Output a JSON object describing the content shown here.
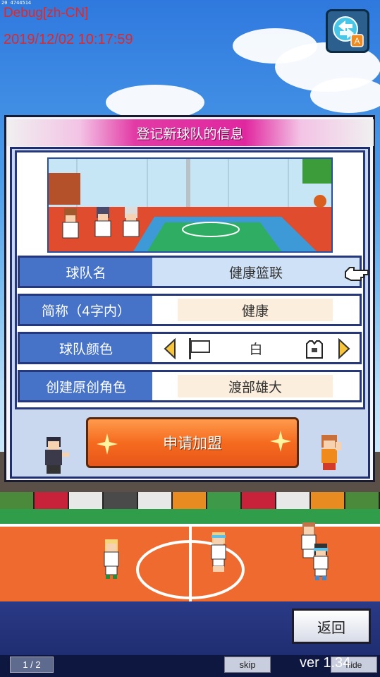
{
  "debug": {
    "build_id": "20 4744514",
    "language": "Debug[zh-CN]",
    "datetime": "2019/12/02 10:17:59"
  },
  "dialog": {
    "title": "登记新球队的信息",
    "rows": [
      {
        "label": "球队名",
        "value": "健康篮联"
      },
      {
        "label": "简称（4字内）",
        "value": "健康"
      },
      {
        "label": "球队颜色",
        "value": "白"
      },
      {
        "label": "创建原创角色",
        "value": "渡部雄大"
      }
    ],
    "join_button": "申请加盟"
  },
  "footer": {
    "back_button": "返回",
    "page_indicator": "1 / 2",
    "skip_button": "skip",
    "version": "ver 1.34",
    "hide_button": "hide"
  },
  "icons": {
    "language_switch": "globe-translate-icon",
    "pointer": "pointing-hand-icon",
    "flag": "flag-icon",
    "jersey": "jersey-icon",
    "prev": "arrow-left-icon",
    "next": "arrow-right-icon"
  },
  "colors": {
    "header_pink": "#e0279f",
    "row_label_blue": "#4673c7",
    "join_orange": "#f56b1f",
    "debug_red": "#e32626"
  }
}
